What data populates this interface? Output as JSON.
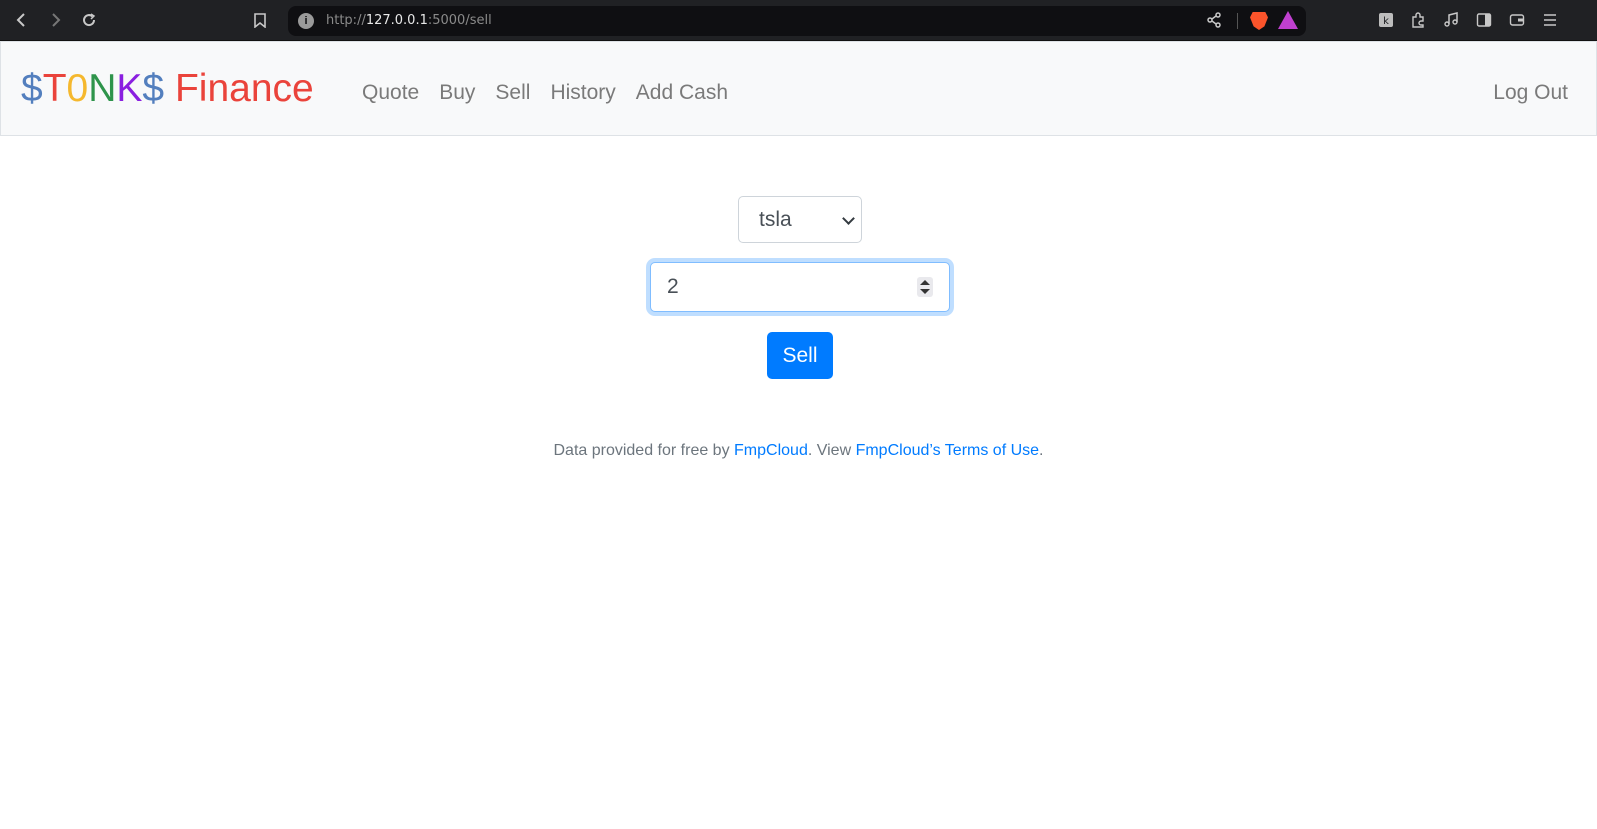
{
  "browser": {
    "url_scheme": "http://",
    "url_host": "127.0.0.1",
    "url_path": ":5000/sell",
    "back_icon": "chevron-left-icon",
    "forward_icon": "chevron-right-icon",
    "reload_icon": "reload-icon",
    "bookmark_icon": "bookmark-icon",
    "info_icon": "info-icon",
    "share_icon": "share-icon",
    "brave_icon": "brave-shield-icon",
    "rewards_icon": "rewards-icon",
    "toolbar_icons": [
      "leo-icon",
      "extensions-icon",
      "media-icon",
      "sidebar-icon",
      "wallet-icon",
      "menu-icon"
    ]
  },
  "brand": {
    "letters": [
      "$",
      "T",
      "0",
      "N",
      "K",
      "$"
    ],
    "word": "Finance",
    "colors": {
      "blue": "#537fbe",
      "red": "#ea433b",
      "yellow": "#f5b82e",
      "green": "#2e944b",
      "purple": "#8a1fe0"
    }
  },
  "nav": {
    "links": [
      "Quote",
      "Buy",
      "Sell",
      "History",
      "Add Cash"
    ],
    "logout": "Log Out"
  },
  "form": {
    "symbol_selected": "tsla",
    "shares_value": "2",
    "submit_label": "Sell"
  },
  "footer": {
    "prefix": "Data provided for free by ",
    "link1": "FmpCloud",
    "middle": ". View ",
    "link2": "FmpCloud’s Terms of Use",
    "suffix": "."
  },
  "colors": {
    "primary": "#007bff",
    "navbar_bg": "#f8f9fa",
    "chrome_bg": "#202124"
  }
}
